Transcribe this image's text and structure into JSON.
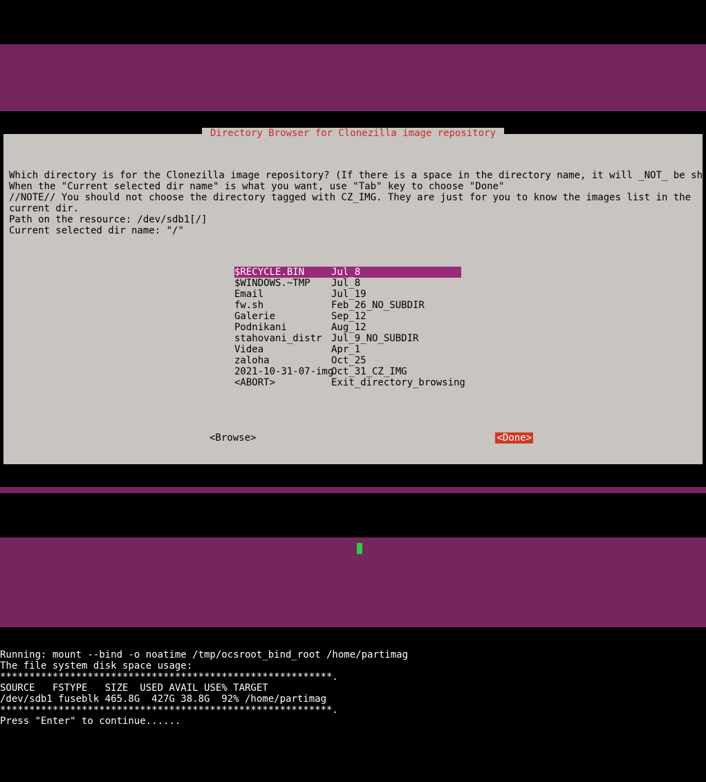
{
  "dialog": {
    "title": " Directory Browser for Clonezilla image repository ",
    "instructions": "Which directory is for the Clonezilla image repository? (If there is a space in the directory name, it will _NOT_ be shown)\nWhen the \"Current selected dir name\" is what you want, use \"Tab\" key to choose \"Done\"\n//NOTE// You should not choose the directory tagged with CZ_IMG. They are just for you to know the images list in the\ncurrent dir.\nPath on the resource: /dev/sdb1[/]\nCurrent selected dir name: \"/\"",
    "items": [
      {
        "name": "$RECYCLE.BIN",
        "info": "Jul_8",
        "selected": true
      },
      {
        "name": "$WINDOWS.~TMP",
        "info": "Jul_8",
        "selected": false
      },
      {
        "name": "Email",
        "info": "Jul_19",
        "selected": false
      },
      {
        "name": "fw.sh",
        "info": "Feb_26_NO_SUBDIR",
        "selected": false
      },
      {
        "name": "Galerie",
        "info": "Sep_12",
        "selected": false
      },
      {
        "name": "Podnikani",
        "info": "Aug_12",
        "selected": false
      },
      {
        "name": "stahovani_distr",
        "info": "Jul_9_NO_SUBDIR",
        "selected": false
      },
      {
        "name": "Videa",
        "info": "Apr_1",
        "selected": false
      },
      {
        "name": "zaloha",
        "info": "Oct_25",
        "selected": false
      },
      {
        "name": "2021-10-31-07-img",
        "info": "Oct_31_CZ_IMG",
        "selected": false
      },
      {
        "name": "<ABORT>",
        "info": "Exit_directory_browsing",
        "selected": false
      }
    ],
    "browse_label": "<Browse>",
    "done_label": "<Done>"
  },
  "console": {
    "lines": "Running: mount --bind -o noatime /tmp/ocsroot_bind_root /home/partimag\nThe file system disk space usage:\n*********************************************************.\nSOURCE   FSTYPE   SIZE  USED AVAIL USE% TARGET\n/dev/sdb1 fuseblk 465.8G  427G 38.8G  92% /home/partimag\n*********************************************************.\nPress \"Enter\" to continue......"
  }
}
